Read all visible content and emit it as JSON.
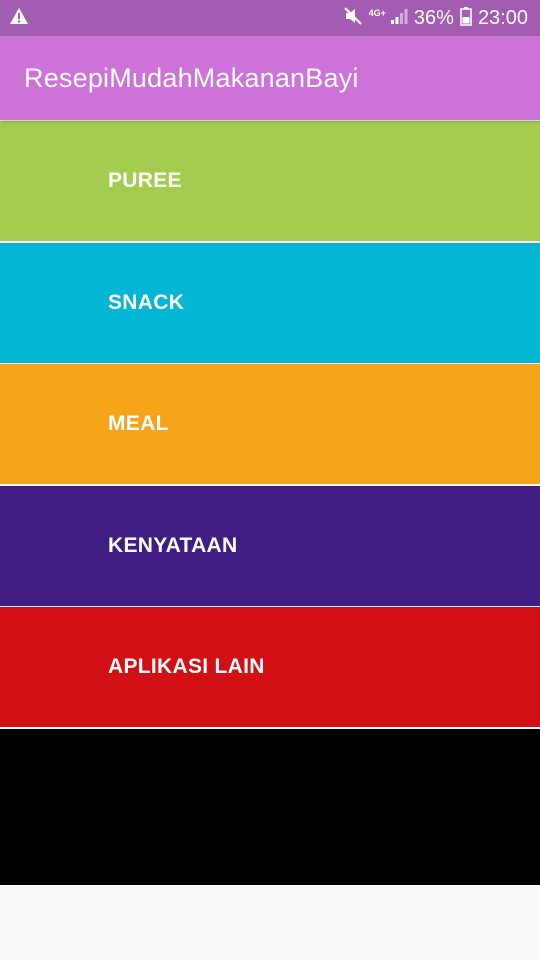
{
  "status_bar": {
    "battery_percent": "36%",
    "time": "23:00",
    "network_label": "4G+",
    "icons": [
      "warning-icon",
      "mute-icon",
      "network-4g-icon",
      "signal-icon",
      "battery-icon"
    ]
  },
  "app_bar": {
    "title": "ResepiMudahMakananBayi"
  },
  "menu": {
    "items": [
      {
        "label": "PUREE",
        "color": "#a4cc4e"
      },
      {
        "label": "SNACK",
        "color": "#03b7d4"
      },
      {
        "label": "MEAL",
        "color": "#f6a419"
      },
      {
        "label": "KENYATAAN",
        "color": "#3f1d82"
      },
      {
        "label": "APLIKASI LAIN",
        "color": "#d20f14"
      }
    ]
  },
  "colors": {
    "status_bar": "#a25cb1",
    "app_bar": "#cc72d9",
    "bottom_panel": "#000000",
    "background": "#fafafa"
  }
}
